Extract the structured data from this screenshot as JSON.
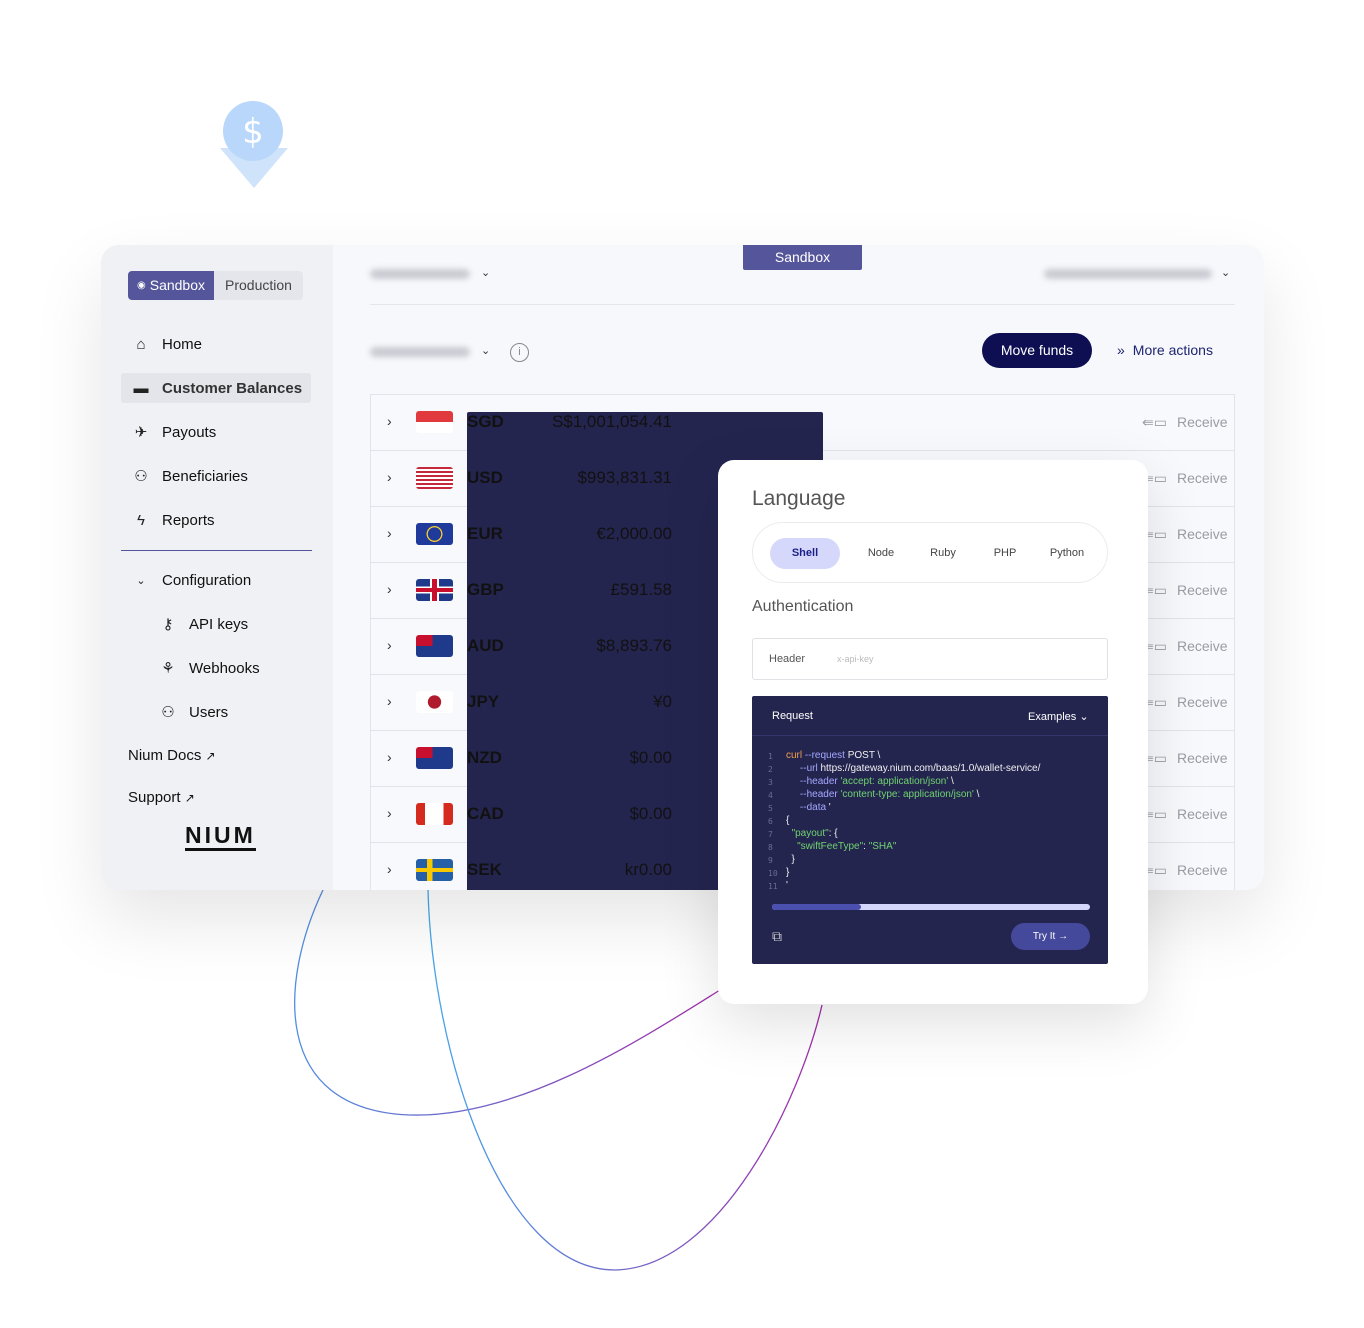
{
  "sidebar": {
    "env_toggle": {
      "sandbox": "Sandbox",
      "production": "Production",
      "active": "Sandbox"
    },
    "nav": [
      {
        "label": "Home",
        "icon": "home-icon"
      },
      {
        "label": "Customer Balances",
        "icon": "wallet-icon",
        "active": true
      },
      {
        "label": "Payouts",
        "icon": "plane-icon"
      },
      {
        "label": "Beneficiaries",
        "icon": "users-icon"
      },
      {
        "label": "Reports",
        "icon": "bolt-icon"
      }
    ],
    "configuration": {
      "label": "Configuration",
      "items": [
        {
          "label": "API keys",
          "icon": "key-icon"
        },
        {
          "label": "Webhooks",
          "icon": "webhook-icon"
        },
        {
          "label": "Users",
          "icon": "users-icon"
        }
      ]
    },
    "links": [
      {
        "label": "Nium Docs",
        "icon": "external-link-icon"
      },
      {
        "label": "Support",
        "icon": "external-link-icon"
      }
    ],
    "logo": "NIUM"
  },
  "header": {
    "env_badge": "Sandbox"
  },
  "toolbar": {
    "move_funds": "Move funds",
    "more_actions": "More actions"
  },
  "balances": [
    {
      "code": "SGD",
      "amount": "S$1,001,054.41",
      "action": "Receive"
    },
    {
      "code": "USD",
      "amount": "$993,831.31",
      "action": "Receive"
    },
    {
      "code": "EUR",
      "amount": "€2,000.00",
      "action": "Receive"
    },
    {
      "code": "GBP",
      "amount": "£591.58",
      "action": "Receive"
    },
    {
      "code": "AUD",
      "amount": "$8,893.76",
      "action": "Receive"
    },
    {
      "code": "JPY",
      "amount": "¥0",
      "action": "Receive"
    },
    {
      "code": "NZD",
      "amount": "$0.00",
      "action": "Receive"
    },
    {
      "code": "CAD",
      "amount": "$0.00",
      "action": "Receive"
    },
    {
      "code": "SEK",
      "amount": "kr0.00",
      "action": "Receive"
    }
  ],
  "api_panel": {
    "language_title": "Language",
    "languages": [
      "Shell",
      "Node",
      "Ruby",
      "PHP",
      "Python"
    ],
    "selected_language": "Shell",
    "auth_title": "Authentication",
    "auth_header_label": "Header",
    "auth_header_placeholder": "x-api-key",
    "request_label": "Request",
    "examples_label": "Examples",
    "code_lines": [
      "curl --request POST \\",
      "     --url https://gateway.nium.com/baas/1.0/wallet-service/",
      "     --header 'accept: application/json' \\",
      "     --header 'content-type: application/json' \\",
      "     --data '",
      "{",
      "  \"payout\": {",
      "    \"swiftFeeType\": \"SHA\"",
      "  }",
      "}",
      "'"
    ],
    "progress": 0.28,
    "try_label": "Try It"
  },
  "colors": {
    "accent": "#55559b",
    "primary_button": "#0d0f52",
    "code_bg": "#24254f"
  }
}
